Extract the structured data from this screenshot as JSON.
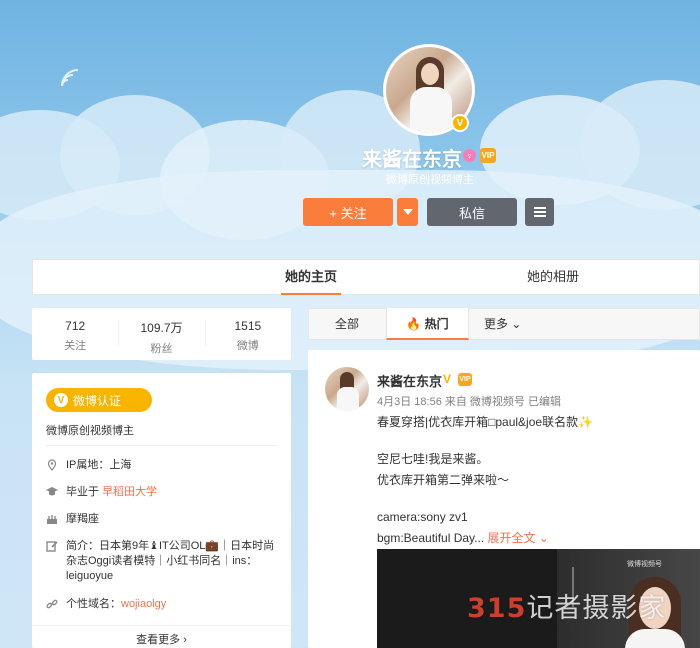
{
  "profile": {
    "name": "来酱在东京",
    "subtitle": "微博原创视频博主",
    "vip_label": "VIP",
    "follow_label": "+ 关注",
    "message_label": "私信"
  },
  "nav": {
    "home": "她的主页",
    "album": "她的相册"
  },
  "stats": [
    {
      "value": "712",
      "label": "关注"
    },
    {
      "value": "109.7万",
      "label": "粉丝"
    },
    {
      "value": "1515",
      "label": "微博"
    }
  ],
  "info": {
    "verify_badge": "微博认证",
    "verify_text": "微博原创视频博主",
    "ip": "IP属地：上海",
    "school_prefix": "毕业于 ",
    "school": "早稻田大学",
    "zodiac": "摩羯座",
    "bio": "简介：日本第9年⁠♝IT公司OL💼｜日本时尚杂志Oggi读者模特｜小红书同名｜ins：leiguoyue",
    "domain_label": "个性域名：",
    "domain": "wojiaolgy",
    "see_more": "查看更多"
  },
  "feed_tabs": {
    "all": "全部",
    "hot": "热门",
    "more": "更多"
  },
  "post": {
    "author": "来酱在东京",
    "meta": "4月3日 18:56 来自 微博视频号  已编辑",
    "lines": [
      "春夏穿搭|优衣库开箱□paul&joe联名款✨",
      "",
      "空尼七哇!我是来酱。",
      "优衣库开箱第二弹来啦～",
      "",
      "camera:sony zv1"
    ],
    "last_line": "bgm:Beautiful Day... ",
    "expand": "展开全文",
    "video_brand": "微博视频号"
  },
  "watermark": {
    "number": "315",
    "text": "记者摄影家"
  },
  "colors": {
    "accent": "#fa7d3c",
    "dark_button": "#62666e",
    "verify": "#f7b500",
    "link": "#eb7350"
  }
}
